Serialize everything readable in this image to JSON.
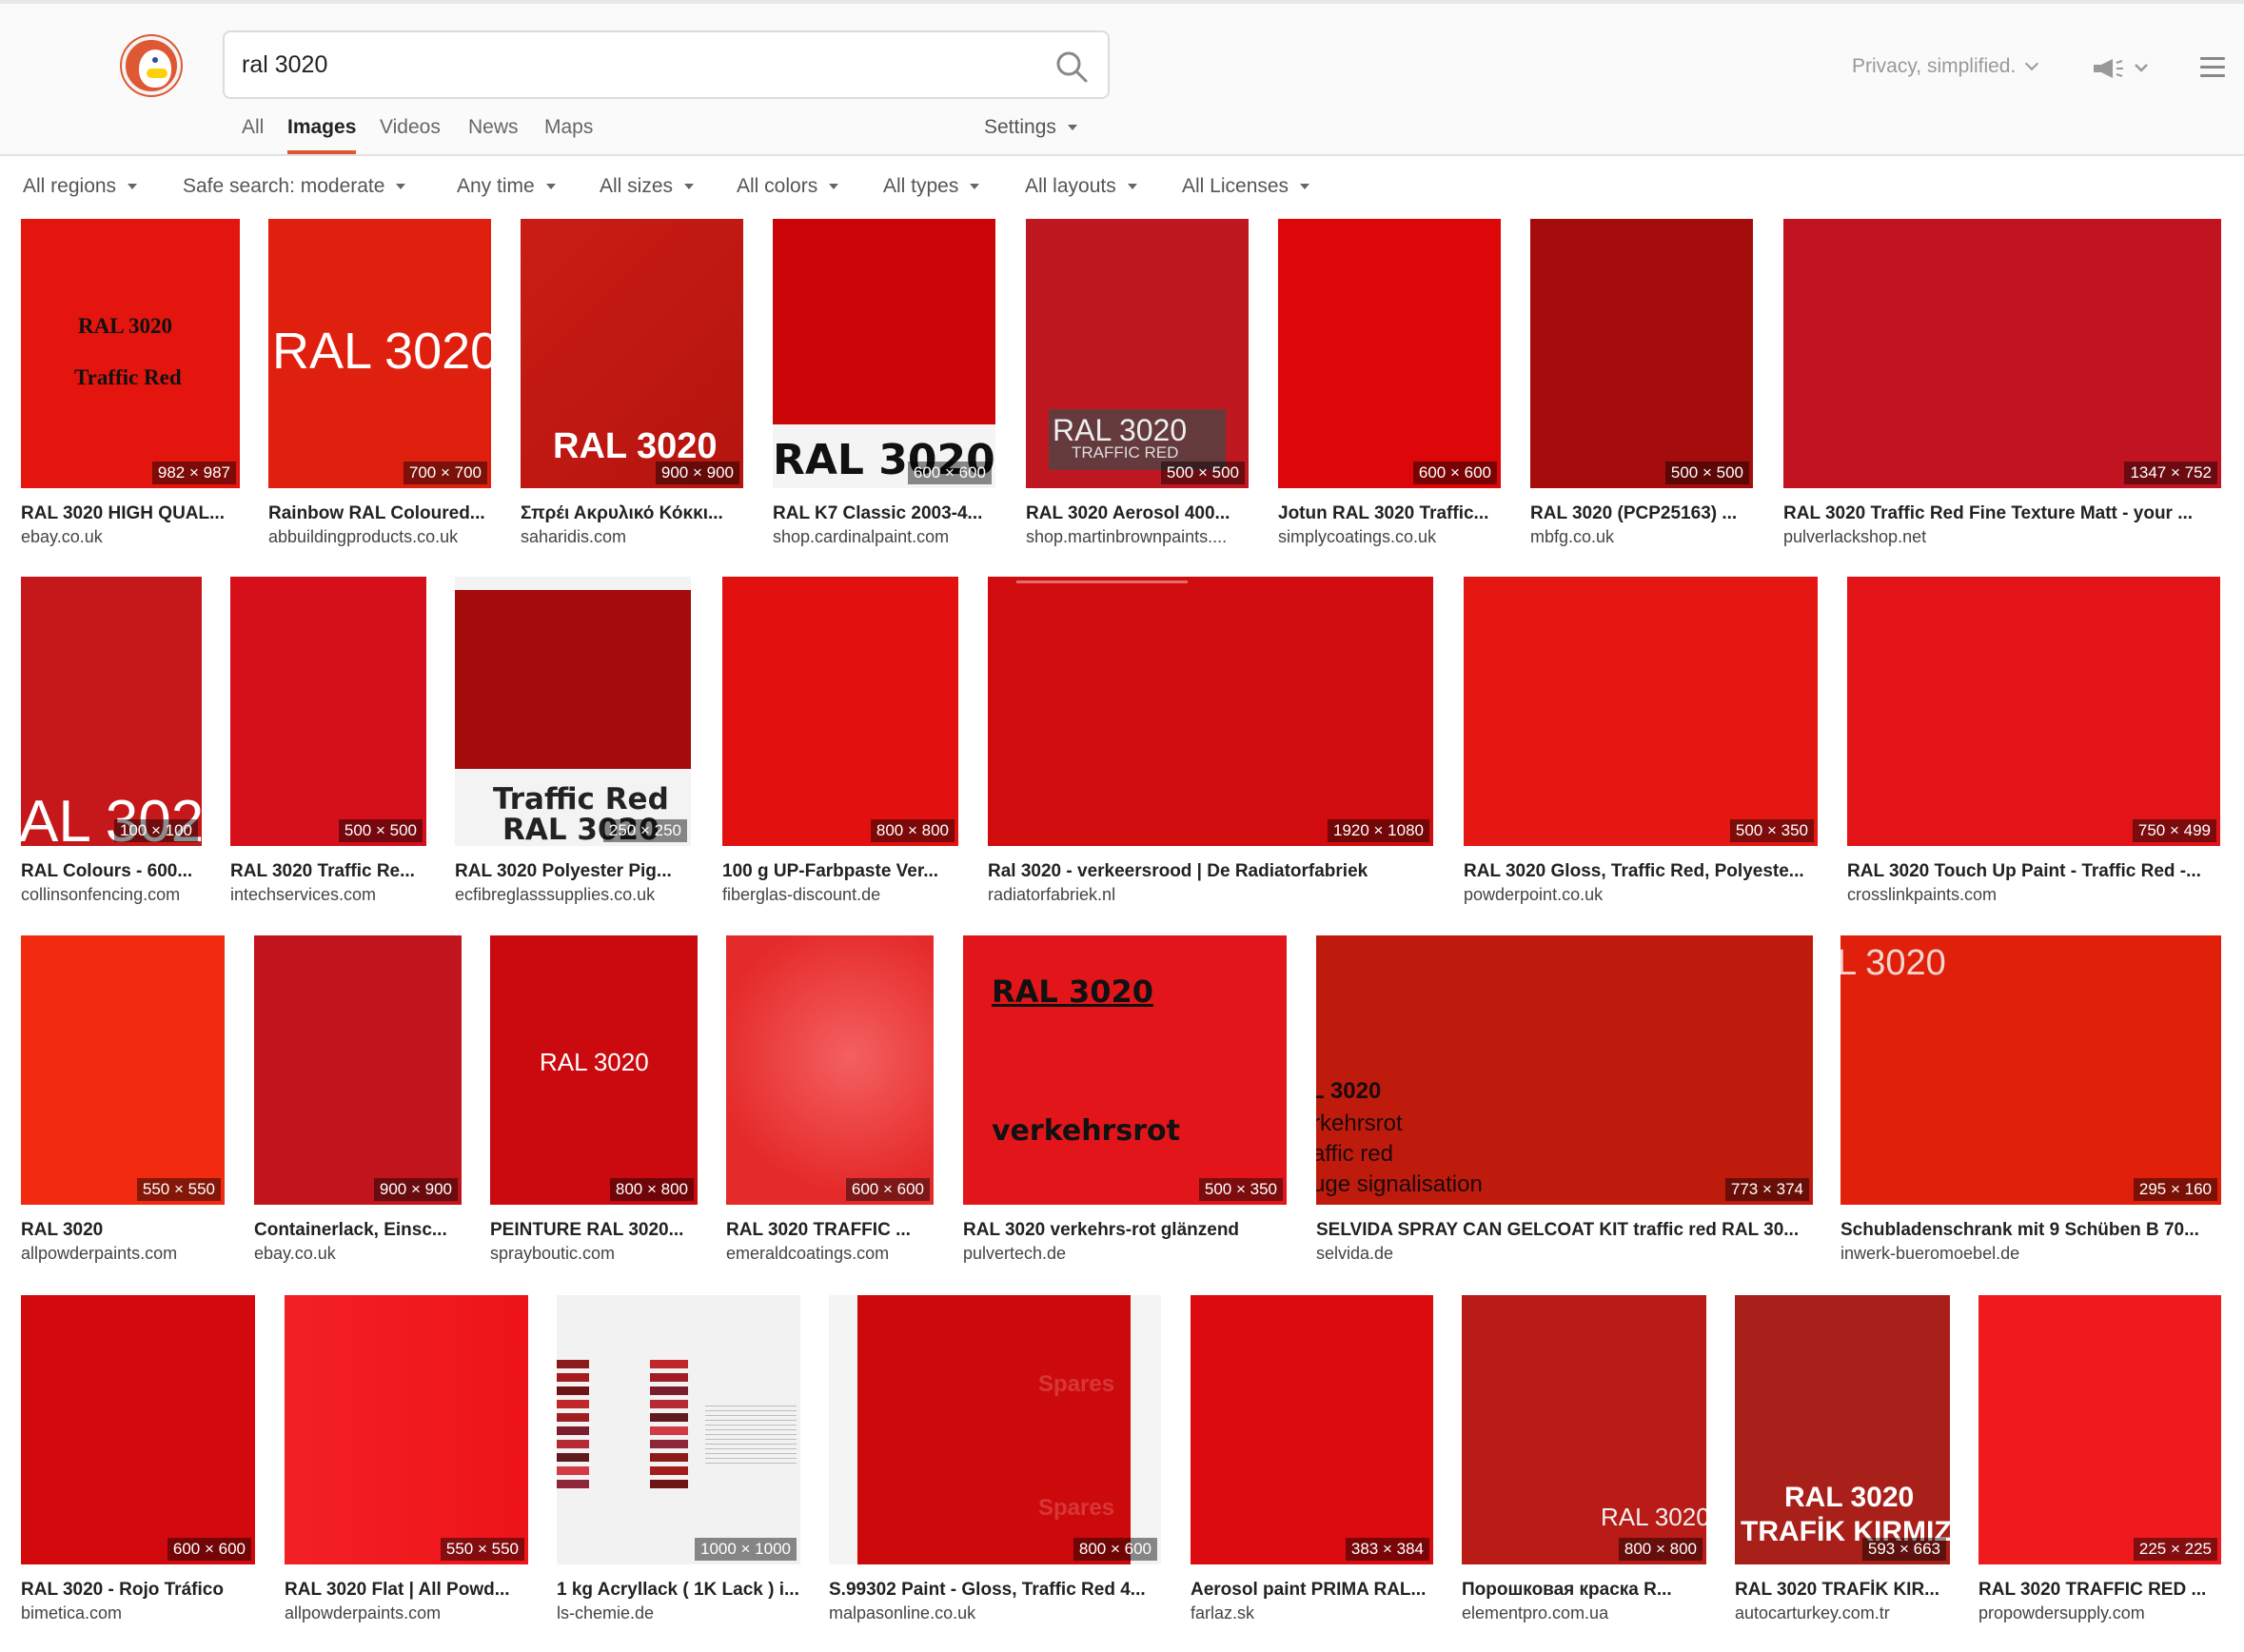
{
  "search": {
    "query": "ral 3020",
    "placeholder": ""
  },
  "tabs": [
    {
      "label": "All",
      "active": false
    },
    {
      "label": "Images",
      "active": true
    },
    {
      "label": "Videos",
      "active": false
    },
    {
      "label": "News",
      "active": false
    },
    {
      "label": "Maps",
      "active": false
    }
  ],
  "settings_label": "Settings",
  "privacy_label": "Privacy, simplified.",
  "filters": [
    "All regions",
    "Safe search: moderate",
    "Any time",
    "All sizes",
    "All colors",
    "All types",
    "All layouts",
    "All Licenses"
  ],
  "colors": {
    "accent": "#de5833",
    "text": "#222222",
    "muted": "#666666"
  },
  "results": [
    {
      "title": "RAL 3020 HIGH QUAL...",
      "source": "ebay.co.uk",
      "dims": "982 × 987",
      "color": "#e4140e",
      "overlay": [
        "RAL 3020",
        "Traffic Red"
      ]
    },
    {
      "title": "Rainbow RAL Coloured...",
      "source": "abbuildingproducts.co.uk",
      "dims": "700 × 700",
      "color": "#e0200f",
      "overlay": [
        "RAL 3020"
      ]
    },
    {
      "title": "Σπρέι Ακρυλικό Κόκκι...",
      "source": "saharidis.com",
      "dims": "900 × 900",
      "color": "#c51912",
      "overlay": [
        "RAL 3020"
      ]
    },
    {
      "title": "RAL K7 Classic 2003-4...",
      "source": "shop.cardinalpaint.com",
      "dims": "600 × 600",
      "color": "#cc0508",
      "overlay": [
        "RAL 3020"
      ]
    },
    {
      "title": "RAL 3020 Aerosol 400...",
      "source": "shop.martinbrownpaints....",
      "dims": "500 × 500",
      "color": "#c01820",
      "overlay": [
        "RAL 3020",
        "TRAFFIC RED"
      ]
    },
    {
      "title": "Jotun RAL 3020 Traffic...",
      "source": "simplycoatings.co.uk",
      "dims": "600 × 600",
      "color": "#dd0608",
      "overlay": []
    },
    {
      "title": "RAL 3020 (PCP25163) ...",
      "source": "mbfg.co.uk",
      "dims": "500 × 500",
      "color": "#a40d0b",
      "overlay": []
    },
    {
      "title": "RAL 3020 Traffic Red Fine Texture Matt - your ...",
      "source": "pulverlackshop.net",
      "dims": "1347 × 752",
      "color": "#c11420",
      "overlay": []
    },
    {
      "title": "RAL Colours - 600...",
      "source": "collinsonfencing.com",
      "dims": "100 × 100",
      "color": "#c6181b",
      "overlay": [
        "AL 302"
      ]
    },
    {
      "title": "RAL 3020 Traffic Re...",
      "source": "intechservices.com",
      "dims": "500 × 500",
      "color": "#d5101a",
      "overlay": []
    },
    {
      "title": "RAL 3020 Polyester Pig...",
      "source": "ecfibreglasssupplies.co.uk",
      "dims": "250 × 250",
      "color": "#a30c0b",
      "overlay": [
        "Traffic Red",
        "RAL 3020"
      ]
    },
    {
      "title": "100 g UP-Farbpaste Ver...",
      "source": "fiberglas-discount.de",
      "dims": "800 × 800",
      "color": "#e2110f",
      "overlay": []
    },
    {
      "title": "Ral 3020 - verkeersrood | De Radiatorfabriek",
      "source": "radiatorfabriek.nl",
      "dims": "1920 × 1080",
      "color": "#d10c0e",
      "overlay": []
    },
    {
      "title": "RAL 3020 Gloss, Traffic Red, Polyeste...",
      "source": "powderpoint.co.uk",
      "dims": "500 × 350",
      "color": "#e41713",
      "overlay": []
    },
    {
      "title": "RAL 3020 Touch Up Paint - Traffic Red -...",
      "source": "crosslinkpaints.com",
      "dims": "750 × 499",
      "color": "#e21418",
      "overlay": []
    },
    {
      "title": "RAL 3020",
      "source": "allpowderpaints.com",
      "dims": "550 × 550",
      "color": "#f12a10",
      "overlay": []
    },
    {
      "title": "Containerlack, Einsc...",
      "source": "ebay.co.uk",
      "dims": "900 × 900",
      "color": "#c1141c",
      "overlay": []
    },
    {
      "title": "PEINTURE RAL 3020...",
      "source": "sprayboutic.com",
      "dims": "800 × 800",
      "color": "#cb0a10",
      "overlay": [
        "RAL 3020"
      ]
    },
    {
      "title": "RAL 3020 TRAFFIC ...",
      "source": "emeraldcoatings.com",
      "dims": "600 × 600",
      "color": "#ee3535",
      "overlay": []
    },
    {
      "title": "RAL 3020 verkehrs-rot glänzend",
      "source": "pulvertech.de",
      "dims": "500 × 350",
      "color": "#e2161a",
      "overlay": [
        "RAL 3020",
        "verkehrsrot"
      ]
    },
    {
      "title": "SELVIDA SPRAY CAN GELCOAT KIT traffic red RAL 30...",
      "source": "selvida.de",
      "dims": "773 × 374",
      "color": "#bf1b0d",
      "overlay": [
        "L 3020",
        "rkehrsrot",
        "affic red",
        "uge signalisation"
      ]
    },
    {
      "title": "Schubladenschrank mit 9 Schüben B 70...",
      "source": "inwerk-bueromoebel.de",
      "dims": "295 × 160",
      "color": "#e0200b",
      "overlay": [
        "L 3020"
      ]
    },
    {
      "title": "RAL 3020 - Rojo Tráfico",
      "source": "bimetica.com",
      "dims": "600 × 600",
      "color": "#d30a0d",
      "overlay": []
    },
    {
      "title": "RAL 3020 Flat | All Powd...",
      "source": "allpowderpaints.com",
      "dims": "550 × 550",
      "color": "#f01a20",
      "overlay": []
    },
    {
      "title": "1 kg Acryllack ( 1K Lack ) i...",
      "source": "ls-chemie.de",
      "dims": "1000 × 1000",
      "color": "#f2f2f2",
      "overlay": []
    },
    {
      "title": "S.99302 Paint - Gloss, Traffic Red 4...",
      "source": "malpasonline.co.uk",
      "dims": "800 × 600",
      "color": "#cd0a0b",
      "overlay": [
        "Spares",
        "Spares"
      ]
    },
    {
      "title": "Aerosol paint PRIMA RAL...",
      "source": "farlaz.sk",
      "dims": "383 × 384",
      "color": "#db0b0f",
      "overlay": []
    },
    {
      "title": "Порошковая краска R...",
      "source": "elementpro.com.ua",
      "dims": "800 × 800",
      "color": "#b91b16",
      "overlay": [
        "RAL 3020"
      ]
    },
    {
      "title": "RAL 3020 TRAFİK KIR...",
      "source": "autocarturkey.com.tr",
      "dims": "593 × 663",
      "color": "#a9201b",
      "overlay": [
        "RAL 3020",
        "TRAFİK KIRMIZI"
      ]
    },
    {
      "title": "RAL 3020 TRAFFIC RED ...",
      "source": "propowdersupply.com",
      "dims": "225 × 225",
      "color": "#ef1a1e",
      "overlay": []
    }
  ]
}
